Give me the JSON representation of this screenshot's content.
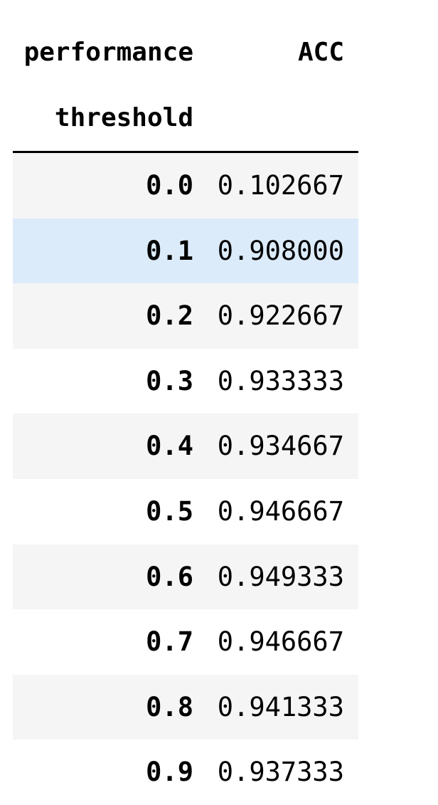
{
  "table": {
    "column_header": "ACC",
    "columns_name": "performance",
    "index_name": "threshold",
    "rows": [
      {
        "index": "0.0",
        "acc": "0.102667"
      },
      {
        "index": "0.1",
        "acc": "0.908000"
      },
      {
        "index": "0.2",
        "acc": "0.922667"
      },
      {
        "index": "0.3",
        "acc": "0.933333"
      },
      {
        "index": "0.4",
        "acc": "0.934667"
      },
      {
        "index": "0.5",
        "acc": "0.946667"
      },
      {
        "index": "0.6",
        "acc": "0.949333"
      },
      {
        "index": "0.7",
        "acc": "0.946667"
      },
      {
        "index": "0.8",
        "acc": "0.941333"
      },
      {
        "index": "0.9",
        "acc": "0.937333"
      }
    ],
    "highlighted_row": 1,
    "colors": {
      "stripe": "#f5f5f5",
      "highlight": "#dcebfa",
      "text": "#000000"
    }
  }
}
